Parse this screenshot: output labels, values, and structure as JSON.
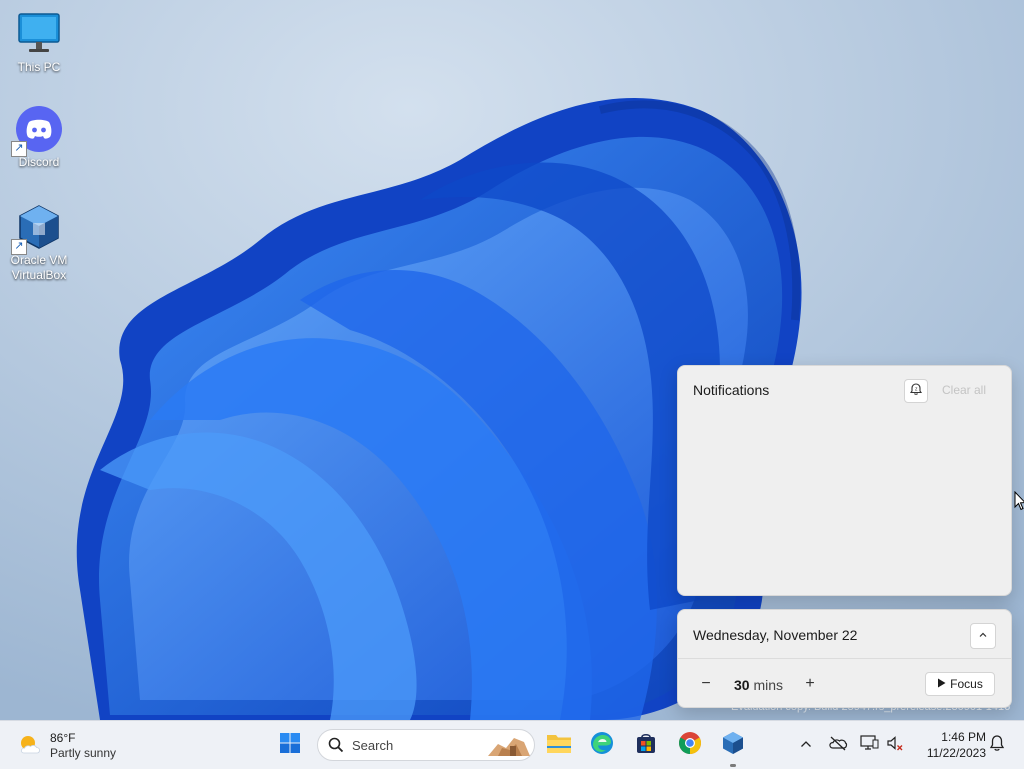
{
  "desktop_icons": [
    {
      "label": "This PC",
      "icon": "monitor-icon"
    },
    {
      "label": "Discord",
      "icon": "discord-icon"
    },
    {
      "label": "Oracle VM\nVirtualBox",
      "icon": "virtualbox-icon"
    }
  ],
  "notifications": {
    "title": "Notifications",
    "clear_all": "Clear all",
    "dnd_icon": "do-not-disturb-icon"
  },
  "calendar": {
    "date": "Wednesday, November 22",
    "focus_minutes": "30",
    "focus_unit": "mins",
    "focus_label": "Focus"
  },
  "watermark": "Evaluation copy. Build 25947.rs_prerelease.230901-1416",
  "taskbar": {
    "weather_temp": "86°F",
    "weather_cond": "Partly sunny",
    "search_placeholder": "Search",
    "apps": [
      "start-icon",
      "file-explorer-icon",
      "edge-icon",
      "store-icon",
      "chrome-icon",
      "virtualbox-icon"
    ],
    "time": "1:46 PM",
    "date": "11/22/2023"
  },
  "colors": {
    "accent": "#0067c0",
    "wallpaper_blue": "#1e6cf0"
  }
}
